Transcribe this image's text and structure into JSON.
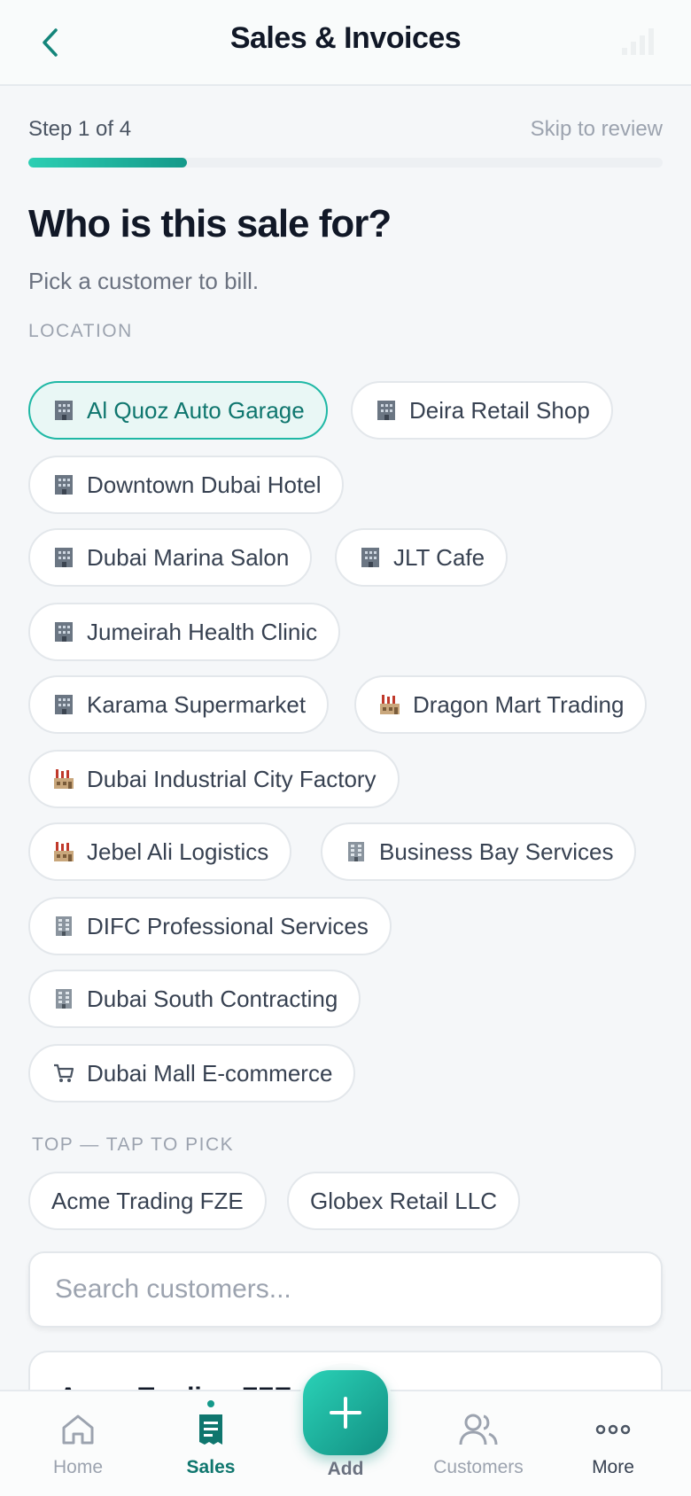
{
  "header": {
    "title": "Sales & Invoices"
  },
  "step": {
    "label": "Step 1 of 4",
    "skip": "Skip to review",
    "progress": 0.25
  },
  "question": {
    "title": "Who is this sale for?",
    "subtitle": "Pick a customer to bill."
  },
  "location": {
    "label": "LOCATION",
    "chips": [
      {
        "label": "Al Quoz Auto Garage",
        "icon": "office-building-icon",
        "selected": true
      },
      {
        "label": "Deira Retail Shop",
        "icon": "office-building-icon"
      },
      {
        "label": "Downtown Dubai Hotel",
        "icon": "office-building-icon"
      },
      {
        "label": "Dubai Marina Salon",
        "icon": "office-building-icon"
      },
      {
        "label": "JLT Cafe",
        "icon": "office-building-icon"
      },
      {
        "label": "Jumeirah Health Clinic",
        "icon": "office-building-icon"
      },
      {
        "label": "Karama Supermarket",
        "icon": "office-building-icon"
      },
      {
        "label": "Dragon Mart Trading",
        "icon": "factory-icon"
      },
      {
        "label": "Dubai Industrial City Factory",
        "icon": "factory-icon"
      },
      {
        "label": "Jebel Ali Logistics",
        "icon": "factory-icon"
      },
      {
        "label": "Business Bay Services",
        "icon": "office-icon"
      },
      {
        "label": "DIFC Professional Services",
        "icon": "office-icon"
      },
      {
        "label": "Dubai South Contracting",
        "icon": "office-icon"
      },
      {
        "label": "Dubai Mall E-commerce",
        "icon": "shopping-cart-icon"
      }
    ]
  },
  "top": {
    "label": "TOP — TAP TO PICK",
    "chips": [
      {
        "label": "Acme Trading FZE"
      },
      {
        "label": "Globex Retail LLC"
      }
    ]
  },
  "search": {
    "placeholder": "Search customers...",
    "value": ""
  },
  "results": [
    {
      "name": "Acme Trading FZE"
    }
  ],
  "nav": {
    "home": "Home",
    "sales": "Sales",
    "add": "Add",
    "customers": "Customers",
    "more": "More"
  },
  "colors": {
    "accent": "#14998a",
    "accent_light": "#2ccfb3",
    "selected_bg": "#e9f7f5"
  }
}
